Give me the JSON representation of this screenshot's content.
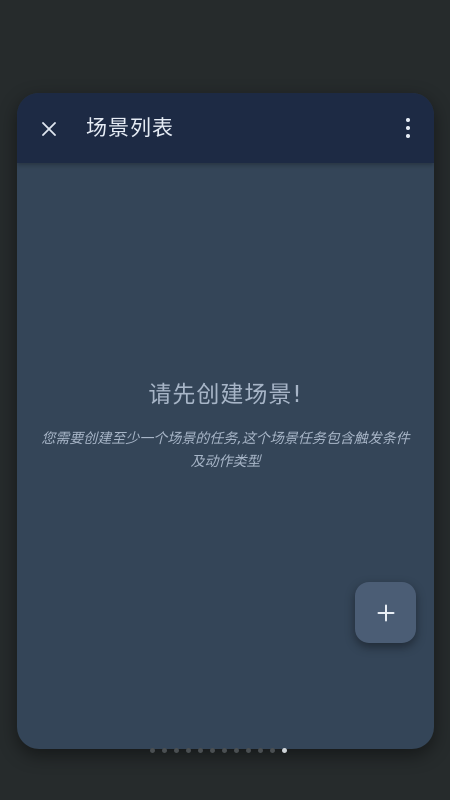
{
  "header": {
    "title": "场景列表",
    "close_icon": "close-icon",
    "more_icon": "more-vert-icon"
  },
  "empty_state": {
    "title": "请先创建场景!",
    "description": "您需要创建至少一个场景的任务,这个场景任务包含触发条件及动作类型"
  },
  "fab": {
    "icon": "plus-icon"
  },
  "pager": {
    "page_count": 12,
    "active_index": 11
  },
  "colors": {
    "background": "#262b2c",
    "card": "#344558",
    "appbar": "#1d2a44",
    "title_text": "#e6ecf5",
    "muted_text": "#a7b5c7",
    "fab": "#4b5d75"
  }
}
